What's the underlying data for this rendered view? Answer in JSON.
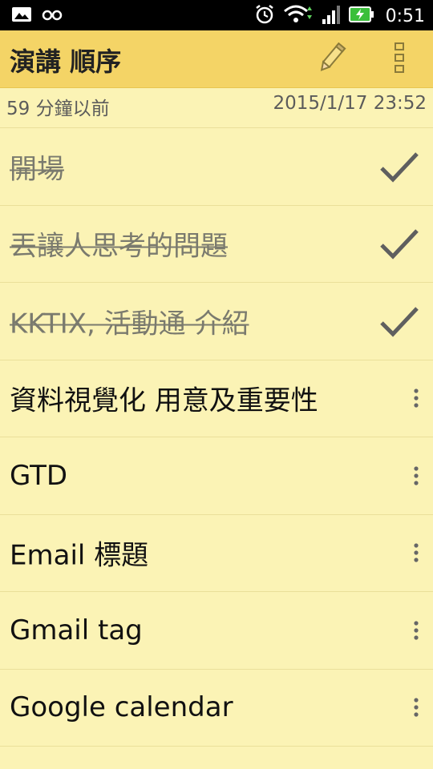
{
  "status_bar": {
    "time": "0:51",
    "left_icons": [
      "image-icon",
      "glasses-icon"
    ],
    "right_icons": [
      "alarm-icon",
      "wifi-icon",
      "signal-icon",
      "battery-charging-icon"
    ]
  },
  "app_bar": {
    "title": "演講 順序",
    "actions": [
      "pencil-icon",
      "overflow-menu-icon"
    ],
    "color": "#f4d466"
  },
  "meta": {
    "modified_ago": "59 分鐘以前",
    "datetime": "2015/1/17 23:52"
  },
  "items": [
    {
      "label": "開場",
      "done": true
    },
    {
      "label": "丟讓人思考的問題",
      "done": true
    },
    {
      "label": "KKTIX, 活動通 介紹",
      "done": true
    },
    {
      "label": "資料視覺化 用意及重要性",
      "done": false
    },
    {
      "label": "GTD",
      "done": false
    },
    {
      "label": "Email 標題",
      "done": false
    },
    {
      "label": "Gmail tag",
      "done": false
    },
    {
      "label": "Google calendar",
      "done": false
    }
  ],
  "colors": {
    "background": "#fbf3b5",
    "done_text": "#7a7a6e",
    "check": "#5f5f5f"
  }
}
